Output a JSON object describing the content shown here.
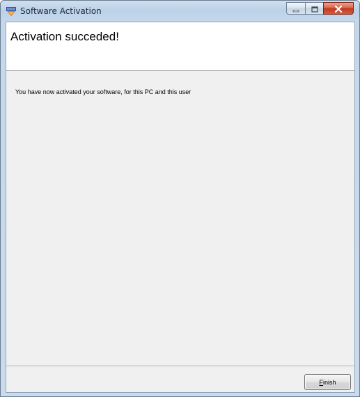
{
  "window": {
    "title": "Software Activation",
    "icon": "app-icon",
    "controls": {
      "minimize": "minimize-icon",
      "maximize": "maximize-icon",
      "close": "close-icon"
    }
  },
  "header": {
    "title": "Activation succeded!"
  },
  "body": {
    "message": "You have now activated your software, for this PC and this user"
  },
  "footer": {
    "finish_accel": "F",
    "finish_rest": "inish"
  },
  "colors": {
    "close_button": "#c13a1e",
    "titlebar": "#bcd2e8",
    "client_bg": "#f0f0f0"
  }
}
